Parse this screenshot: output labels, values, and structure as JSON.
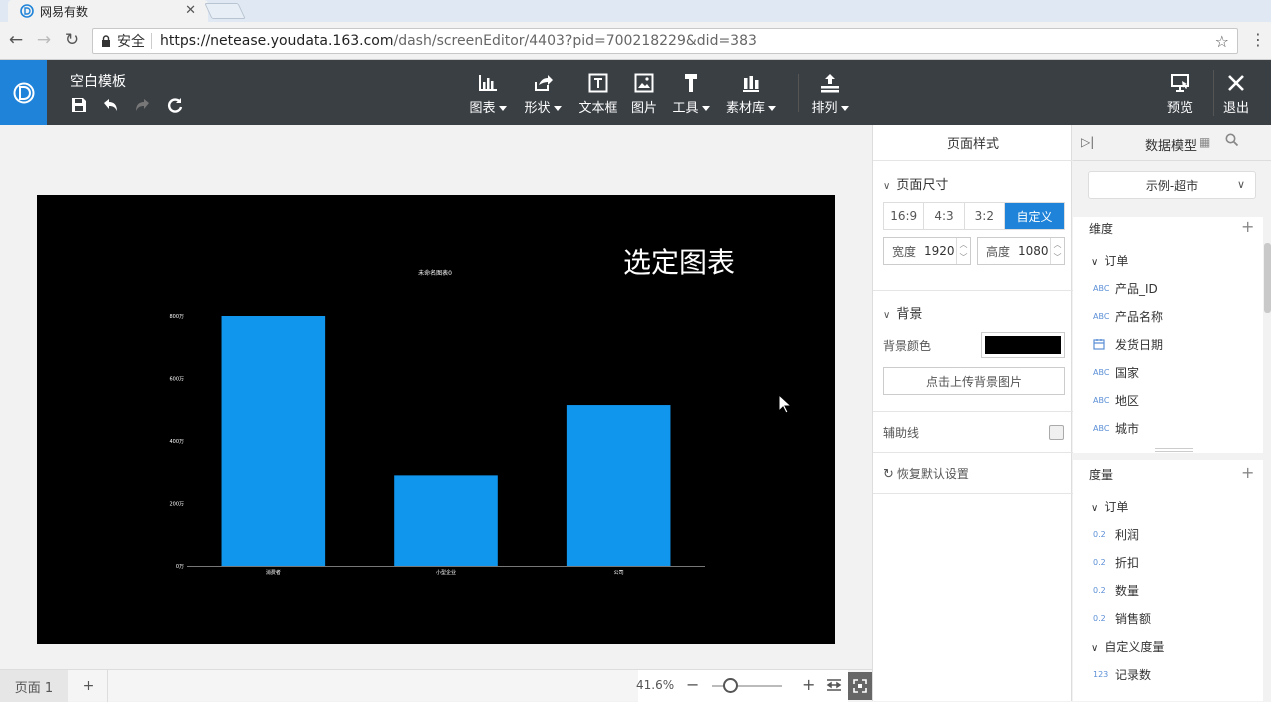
{
  "browser": {
    "tab_title": "网易有数",
    "secure_label": "安全",
    "url_host": "https://netease.youdata.163.com",
    "url_path": "/dash/screenEditor/4403?pid=700218229&did=383"
  },
  "header": {
    "doc_title": "空白模板",
    "tools": [
      {
        "label": "图表",
        "icon": "bar-chart-icon"
      },
      {
        "label": "形状",
        "icon": "shape-icon"
      },
      {
        "label": "文本框",
        "icon": "textbox-icon"
      },
      {
        "label": "图片",
        "icon": "image-icon"
      },
      {
        "label": "工具",
        "icon": "hammer-icon"
      },
      {
        "label": "素材库",
        "icon": "library-icon"
      },
      {
        "label": "排列",
        "icon": "arrange-icon"
      }
    ],
    "preview_label": "预览",
    "exit_label": "退出"
  },
  "canvas": {
    "hint": "选定图表",
    "page_tab": "页面 1",
    "add_page": "+",
    "zoom": "41.6%"
  },
  "chart_data": {
    "type": "bar",
    "title": "未命名图表0",
    "categories": [
      "消费者",
      "小型企业",
      "公司"
    ],
    "values": [
      8000000,
      2900000,
      5150000
    ],
    "yticks": [
      "0万",
      "200万",
      "400万",
      "600万",
      "800万"
    ],
    "ylim": [
      0,
      8000000
    ],
    "bar_color": "#1196ee",
    "background": "#000000",
    "grid": false
  },
  "style_panel": {
    "title": "页面样式",
    "size_section": "页面尺寸",
    "ratios": [
      "16:9",
      "4:3",
      "3:2",
      "自定义"
    ],
    "width_label": "宽度",
    "width_value": "1920",
    "height_label": "高度",
    "height_value": "1080",
    "bg_section": "背景",
    "bg_color_label": "背景颜色",
    "bg_color": "#000000",
    "upload_label": "点击上传背景图片",
    "guide_label": "辅助线",
    "reset_label": "恢复默认设置"
  },
  "data_panel": {
    "title": "数据模型",
    "dataset": "示例-超市",
    "dim_title": "维度",
    "dim_group": "订单",
    "dimensions": [
      {
        "type": "ABC",
        "name": "产品_ID"
      },
      {
        "type": "ABC",
        "name": "产品名称"
      },
      {
        "type": "date",
        "name": "发货日期"
      },
      {
        "type": "ABC",
        "name": "国家"
      },
      {
        "type": "ABC",
        "name": "地区"
      },
      {
        "type": "ABC",
        "name": "城市"
      }
    ],
    "meas_title": "度量",
    "meas_group": "订单",
    "measures": [
      {
        "type": "0.2",
        "name": "利润"
      },
      {
        "type": "0.2",
        "name": "折扣"
      },
      {
        "type": "0.2",
        "name": "数量"
      },
      {
        "type": "0.2",
        "name": "销售额"
      }
    ],
    "custom_group": "自定义度量",
    "custom_measures": [
      {
        "type": "123",
        "name": "记录数"
      }
    ]
  }
}
